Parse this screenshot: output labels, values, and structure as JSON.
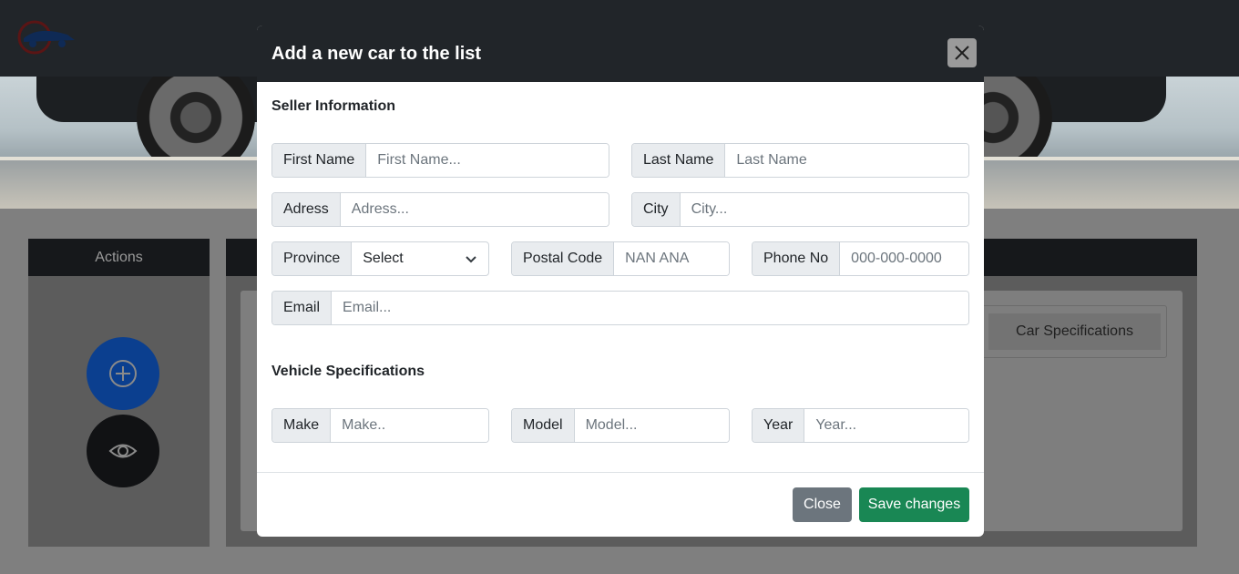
{
  "modal": {
    "title": "Add a new car to the list",
    "seller_section": "Seller Information",
    "vehicle_section": "Vehicle Specifications",
    "fields": {
      "first_name": {
        "label": "First Name",
        "placeholder": "First Name..."
      },
      "last_name": {
        "label": "Last Name",
        "placeholder": "Last Name"
      },
      "address": {
        "label": "Adress",
        "placeholder": "Adress..."
      },
      "city": {
        "label": "City",
        "placeholder": "City..."
      },
      "province": {
        "label": "Province",
        "value": "Select"
      },
      "postal_code": {
        "label": "Postal Code",
        "placeholder": "NAN ANA"
      },
      "phone": {
        "label": "Phone No",
        "placeholder": "000-000-0000"
      },
      "email": {
        "label": "Email",
        "placeholder": "Email..."
      },
      "make": {
        "label": "Make",
        "placeholder": "Make.."
      },
      "model": {
        "label": "Model",
        "placeholder": "Model..."
      },
      "year": {
        "label": "Year",
        "placeholder": "Year..."
      }
    },
    "buttons": {
      "close": "Close",
      "save": "Save changes"
    }
  },
  "background": {
    "actions_title": "Actions",
    "car_spec_tab": "Car Specifications"
  },
  "icons": [
    "logo",
    "plus-circle-icon",
    "eye-icon",
    "close-icon",
    "chevron-down-icon"
  ],
  "colors": {
    "primary": "#0d6efd",
    "success": "#198754",
    "secondary": "#6c757d",
    "dark": "#212529"
  }
}
